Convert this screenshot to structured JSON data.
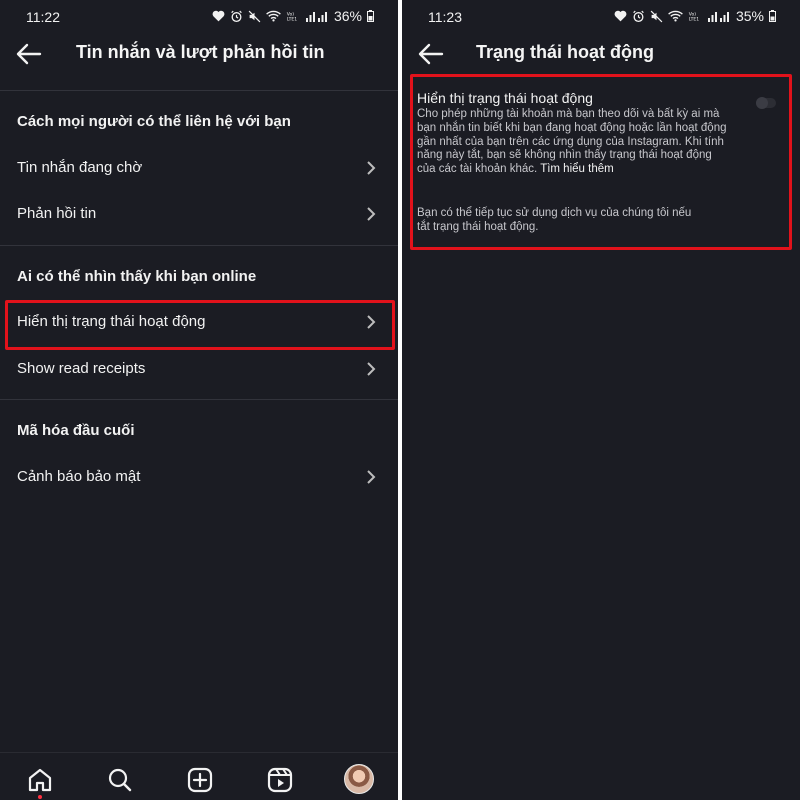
{
  "left": {
    "status": {
      "time": "11:22",
      "battery": "36%"
    },
    "title": "Tin nhắn và lượt phản hồi tin",
    "sections": [
      {
        "header": "Cách mọi người có thể liên hệ với bạn",
        "items": [
          "Tin nhắn đang chờ",
          "Phản hồi tin"
        ]
      },
      {
        "header": "Ai có thể nhìn thấy khi bạn online",
        "items": [
          "Hiển thị trạng thái hoạt động",
          "Show read receipts"
        ]
      },
      {
        "header": "Mã hóa đầu cuối",
        "items": [
          "Cảnh báo bảo mật"
        ]
      }
    ],
    "highlighted_item": "Hiển thị trạng thái hoạt động",
    "nav": [
      "home-icon",
      "search-icon",
      "create-icon",
      "reels-icon",
      "profile-avatar"
    ]
  },
  "right": {
    "status": {
      "time": "11:23",
      "battery": "35%"
    },
    "title": "Trạng thái hoạt động",
    "setting": {
      "title": "Hiển thị trạng thái hoạt động",
      "description": "Cho phép những tài khoản mà bạn theo dõi và bất kỳ ai mà bạn nhắn tin biết khi bạn đang hoạt động hoặc lần hoạt động gần nhất của bạn trên các ứng dụng của Instagram. Khi tính năng này tắt, bạn sẽ không nhìn thấy trạng thái hoạt động của các tài khoản khác.",
      "learn_more": "Tìm hiểu thêm",
      "note": "Bạn có thể tiếp tục sử dụng dịch vụ của chúng tôi nếu tắt trạng thái hoạt động.",
      "enabled": false
    }
  },
  "colors": {
    "background": "#1b1c23",
    "highlight": "#e2121b",
    "divider": "#32333b",
    "text": "#f2f2f2",
    "secondary_text": "#c7c7cc"
  }
}
